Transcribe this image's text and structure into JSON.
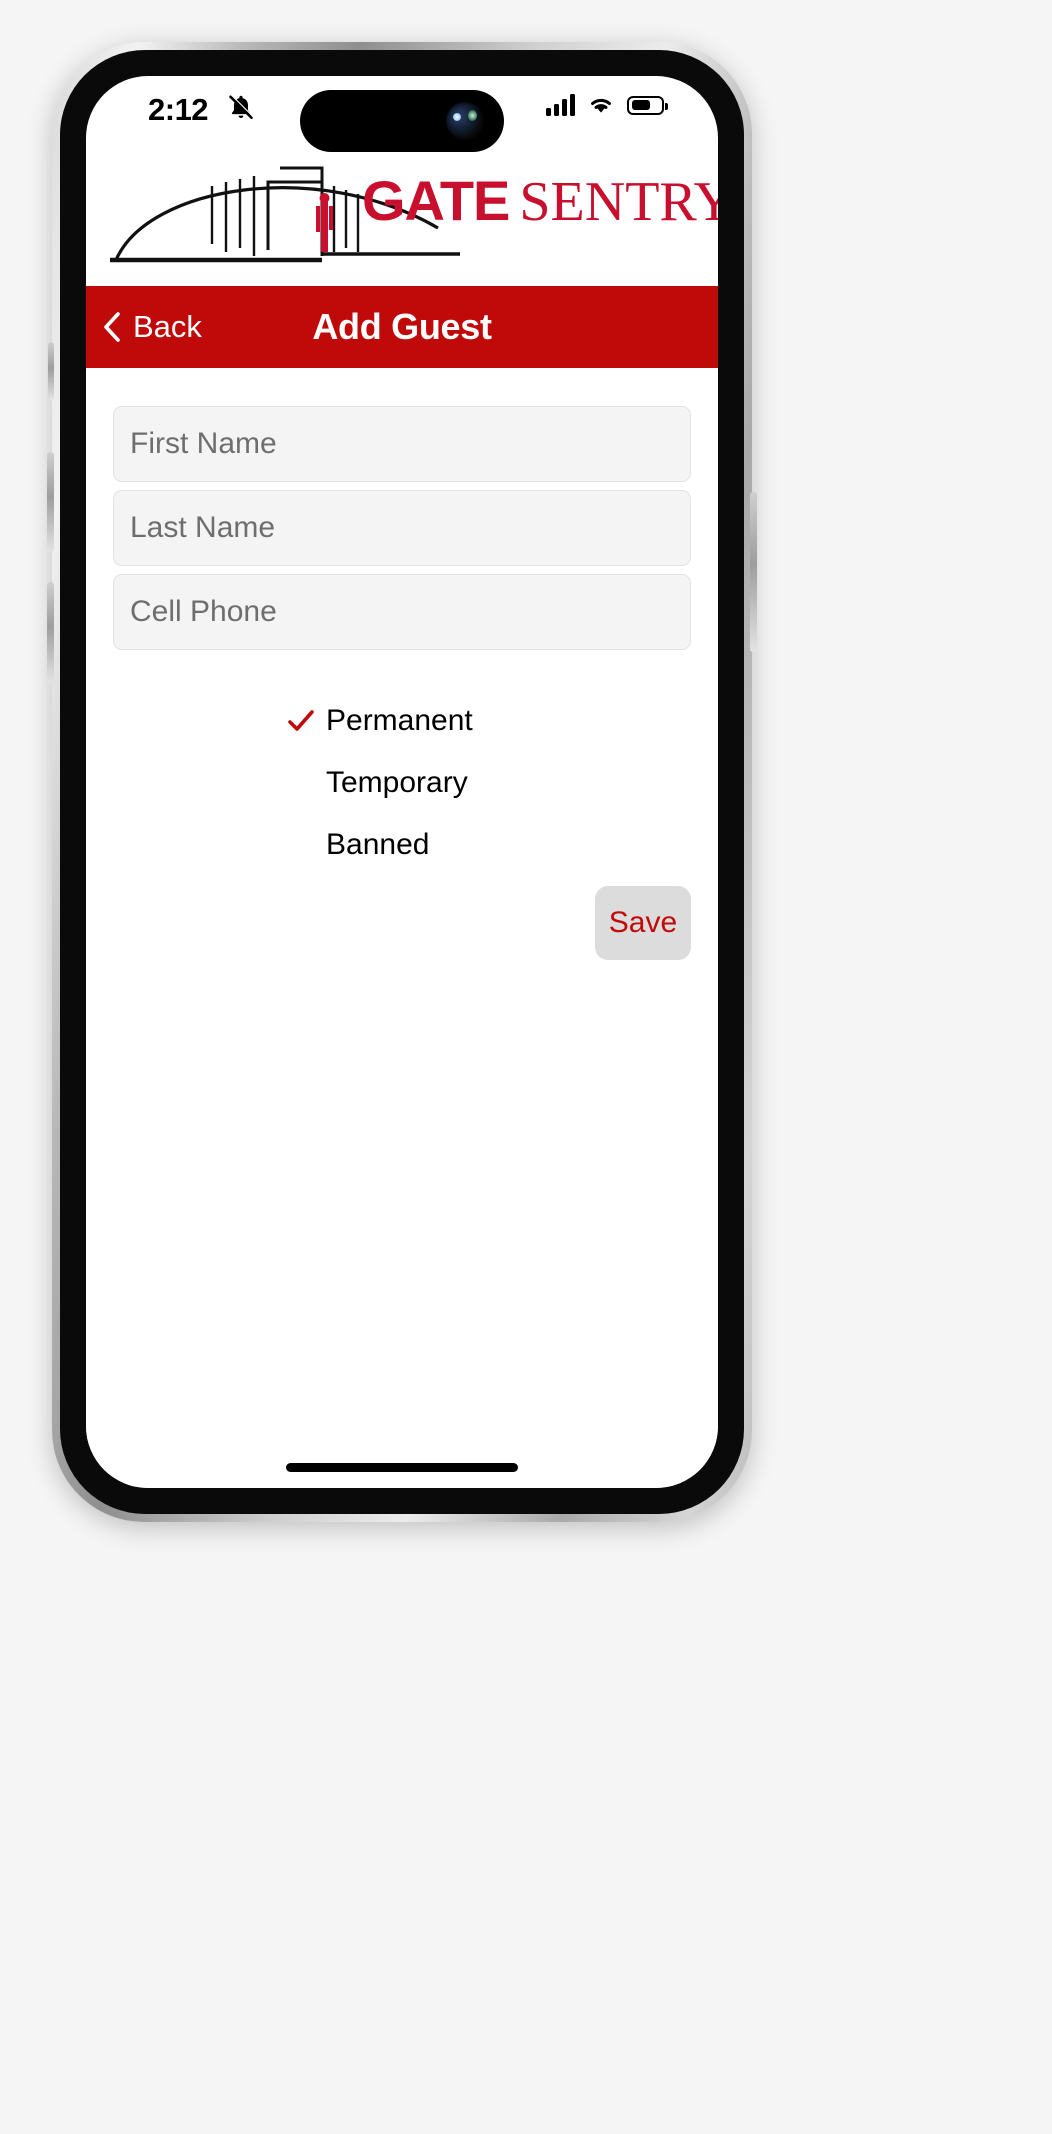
{
  "status_bar": {
    "time": "2:12",
    "bell_icon": "bell-muted-icon",
    "cellular_icon": "cellular-signal-icon",
    "wifi_icon": "wifi-icon",
    "battery_icon": "battery-icon"
  },
  "logo": {
    "mark_icon": "gate-arch-logo-icon",
    "word_primary": "GATE",
    "word_secondary": "SENTRY",
    "color": "#C8102E"
  },
  "nav": {
    "back_label": "Back",
    "back_icon": "chevron-left-icon",
    "title": "Add Guest",
    "background_color": "#C00A0A",
    "text_color": "#FFFFFF"
  },
  "form": {
    "fields": [
      {
        "name": "first-name",
        "placeholder": "First Name",
        "value": ""
      },
      {
        "name": "last-name",
        "placeholder": "Last Name",
        "value": ""
      },
      {
        "name": "cell-phone",
        "placeholder": "Cell Phone",
        "value": ""
      }
    ]
  },
  "access_options": {
    "selected": "Permanent",
    "check_icon": "checkmark-icon",
    "check_color": "#C00A0A",
    "items": [
      {
        "label": "Permanent",
        "checked": true
      },
      {
        "label": "Temporary",
        "checked": false
      },
      {
        "label": "Banned",
        "checked": false
      }
    ]
  },
  "actions": {
    "save_label": "Save",
    "save_text_color": "#C00A0A",
    "save_background": "#DCDCDC"
  }
}
